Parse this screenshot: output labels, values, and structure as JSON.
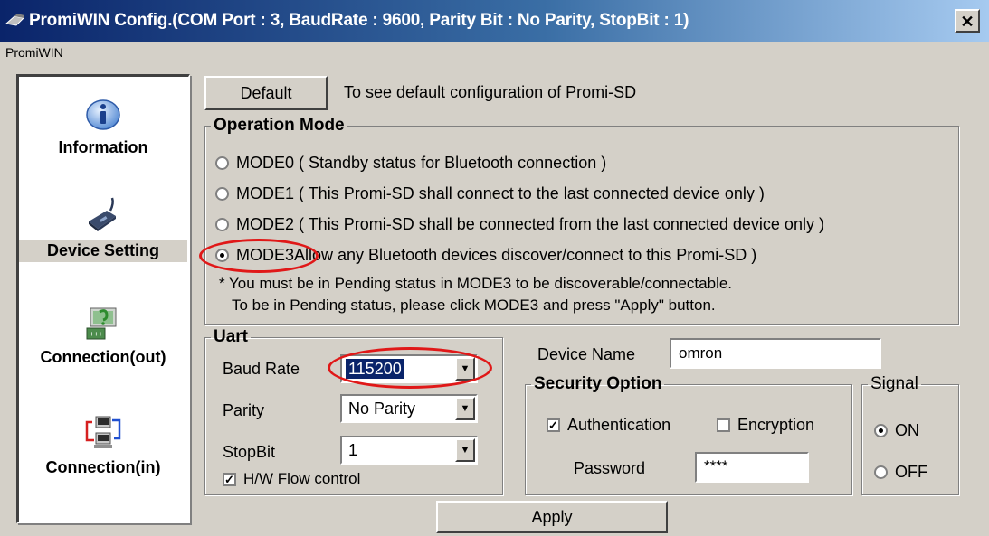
{
  "window": {
    "title": "PromiWIN Config.(COM Port : 3,  BaudRate : 9600,  Parity Bit : No Parity,  StopBit : 1)",
    "close_label": "✕"
  },
  "menu": {
    "label": "PromiWIN"
  },
  "sidebar": {
    "items": [
      {
        "label": "Information",
        "icon": "info-icon"
      },
      {
        "label": "Device Setting",
        "icon": "device-plug-icon"
      },
      {
        "label": "Connection(out)",
        "icon": "connection-out-icon"
      },
      {
        "label": "Connection(in)",
        "icon": "connection-in-icon"
      }
    ]
  },
  "default_row": {
    "button_label": "Default",
    "description": "To see default configuration of Promi-SD"
  },
  "operation_mode": {
    "legend": "Operation Mode",
    "modes": [
      {
        "label": "MODE0 ( Standby status for Bluetooth connection )",
        "checked": false
      },
      {
        "label": "MODE1 ( This Promi-SD shall connect to the last connected device only )",
        "checked": false
      },
      {
        "label": "MODE2 ( This Promi-SD shall be connected from the last connected device only )",
        "checked": false
      },
      {
        "label": "MODE3",
        "label_rest": " Allow any Bluetooth devices discover/connect to this Promi-SD )",
        "checked": true
      }
    ],
    "note_line1": "* You must be in Pending status in MODE3 to be discoverable/connectable.",
    "note_line2": "To be in Pending status, please click MODE3 and press \"Apply\" button."
  },
  "uart": {
    "legend": "Uart",
    "baud_label": "Baud Rate",
    "baud_value": "115200",
    "parity_label": "Parity",
    "parity_value": "No Parity",
    "stopbit_label": "StopBit",
    "stopbit_value": "1",
    "flow_label": "H/W Flow control",
    "flow_checked": true
  },
  "device": {
    "name_label": "Device Name",
    "name_value": "omron"
  },
  "security": {
    "legend": "Security Option",
    "auth_label": "Authentication",
    "auth_checked": true,
    "enc_label": "Encryption",
    "enc_checked": false,
    "password_label": "Password",
    "password_value": "****"
  },
  "signal": {
    "legend": "Signal",
    "on_label": "ON",
    "off_label": "OFF",
    "selected": "ON"
  },
  "apply_label": "Apply",
  "colors": {
    "annotation_red": "#e01818",
    "selection_blue": "#0a246a"
  }
}
